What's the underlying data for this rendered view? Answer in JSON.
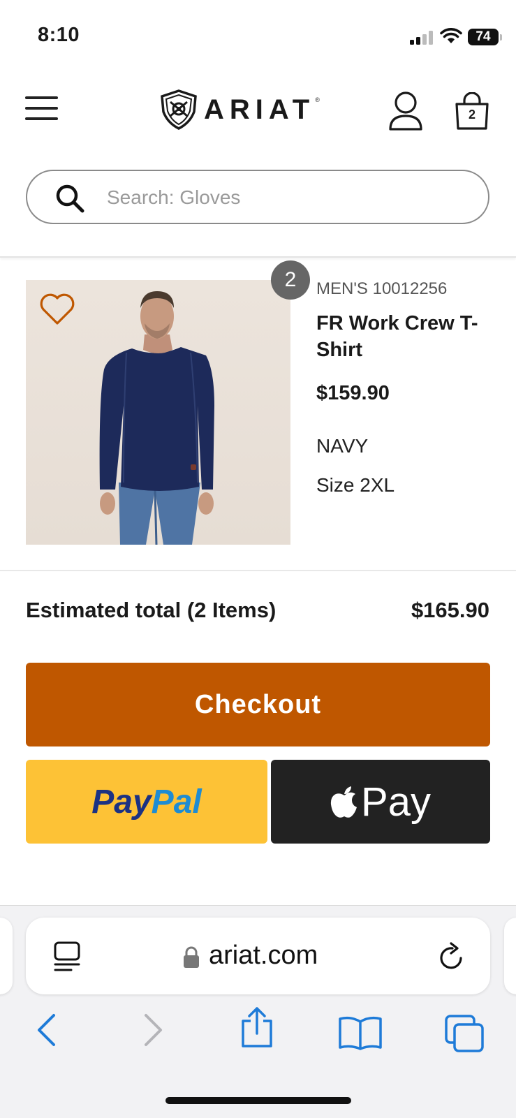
{
  "status_bar": {
    "time": "8:10",
    "battery": "74"
  },
  "header": {
    "brand": "ARIAT",
    "cart_count": "2",
    "search_placeholder": "Search: Gloves"
  },
  "cart_item": {
    "quantity": "2",
    "meta": "MEN'S 10012256",
    "name": "FR Work Crew T-Shirt",
    "price": "$159.90",
    "color": "NAVY",
    "size": "Size 2XL",
    "image_alt": "Man wearing navy long-sleeve crew t-shirt and jeans"
  },
  "summary": {
    "label": "Estimated total (2 Items)",
    "total": "$165.90"
  },
  "buttons": {
    "checkout": "Checkout",
    "paypal_a": "Pay",
    "paypal_b": "Pal",
    "applepay": "Pay"
  },
  "browser": {
    "url": "ariat.com"
  },
  "colors": {
    "accent_orange": "#bf5700",
    "paypal_yellow": "#fdc236",
    "paypal_dark_blue": "#1b3283",
    "paypal_light_blue": "#1e8cd3",
    "ios_blue": "#1e7bd8"
  }
}
